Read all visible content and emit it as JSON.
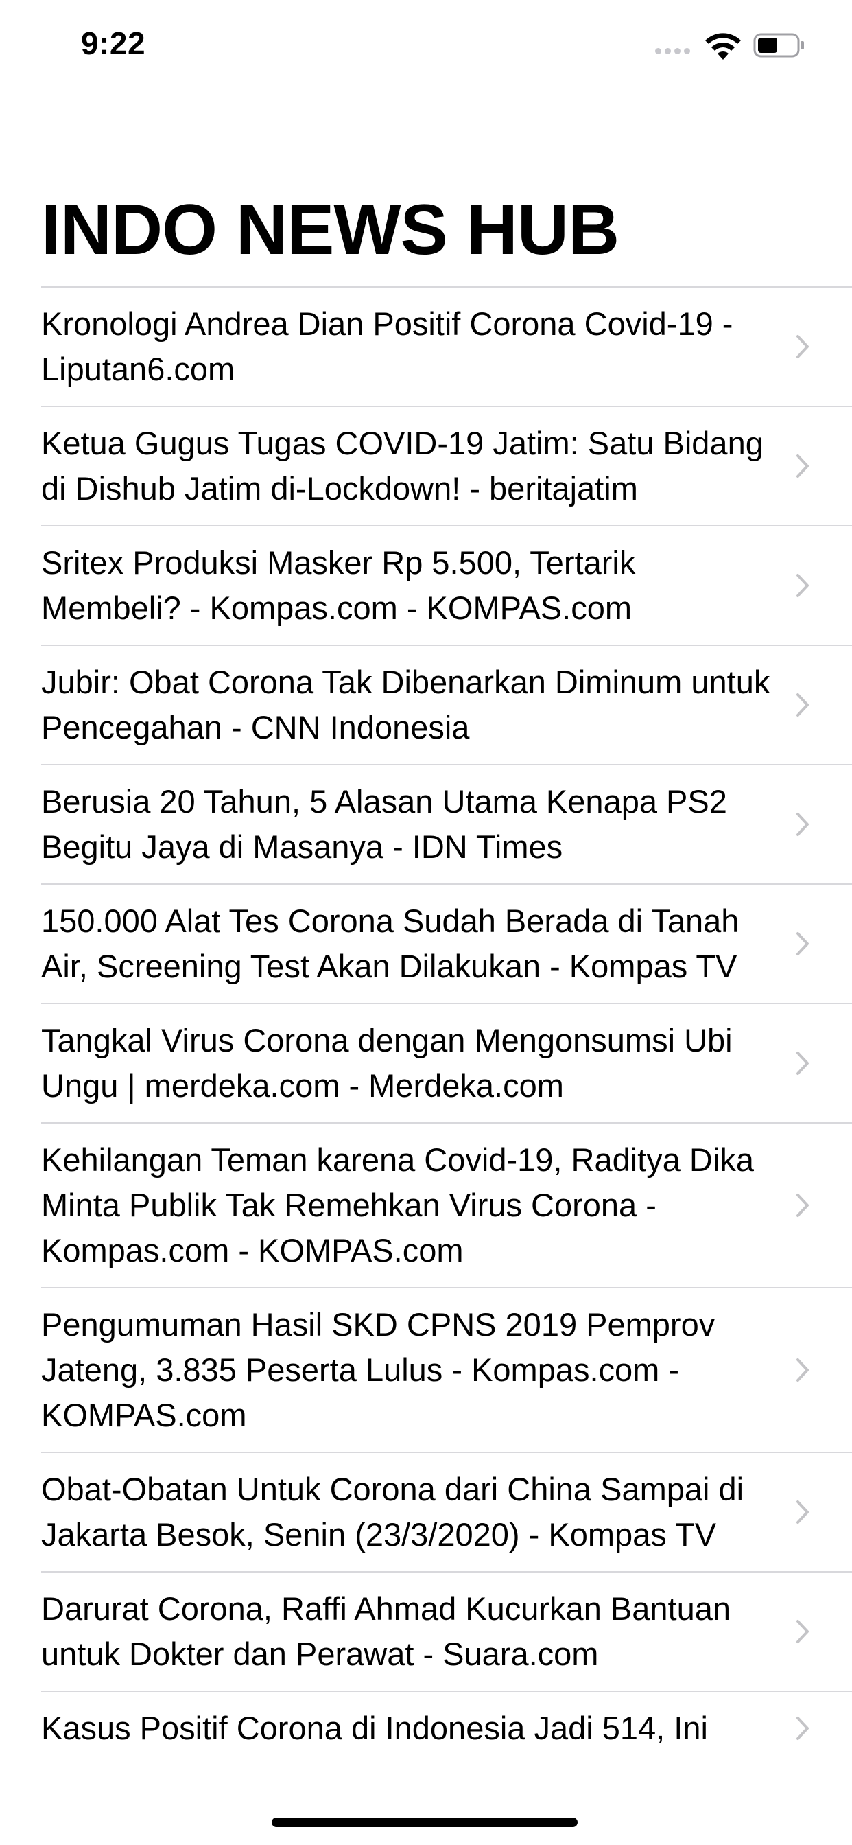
{
  "status_bar": {
    "time": "9:22",
    "icons": [
      "signal-dots-icon",
      "wifi-icon",
      "battery-icon"
    ]
  },
  "header": {
    "title": "INDO NEWS HUB"
  },
  "news_items": [
    {
      "title": "Kronologi Andrea Dian Positif Corona Covid-19 - Liputan6.com"
    },
    {
      "title": "Ketua Gugus Tugas COVID-19 Jatim: Satu Bidang di Dishub Jatim di-Lockdown! - beritajatim"
    },
    {
      "title": "Sritex Produksi Masker Rp 5.500, Tertarik Membeli? - Kompas.com - KOMPAS.com"
    },
    {
      "title": "Jubir: Obat Corona Tak Dibenarkan Diminum untuk Pencegahan - CNN Indonesia"
    },
    {
      "title": "Berusia 20 Tahun, 5 Alasan Utama Kenapa PS2 Begitu Jaya di Masanya - IDN Times"
    },
    {
      "title": "150.000 Alat Tes Corona Sudah Berada di Tanah Air, Screening Test Akan Dilakukan - Kompas TV"
    },
    {
      "title": "Tangkal Virus Corona dengan Mengonsumsi Ubi Ungu | merdeka.com - Merdeka.com"
    },
    {
      "title": "Kehilangan Teman karena Covid-19, Raditya Dika Minta Publik Tak Remehkan Virus Corona - Kompas.com - KOMPAS.com"
    },
    {
      "title": "Pengumuman Hasil SKD CPNS 2019 Pemprov Jateng, 3.835 Peserta Lulus - Kompas.com - KOMPAS.com"
    },
    {
      "title": "Obat-Obatan Untuk Corona dari China Sampai di Jakarta Besok, Senin (23/3/2020) - Kompas TV"
    },
    {
      "title": "Darurat Corona, Raffi Ahmad Kucurkan Bantuan untuk Dokter dan Perawat - Suara.com"
    },
    {
      "title": "Kasus Positif Corona di Indonesia Jadi 514, Ini"
    }
  ],
  "colors": {
    "separator": "#d8d8dc",
    "chevron": "#c4c4c7",
    "text": "#000000",
    "background": "#ffffff"
  }
}
